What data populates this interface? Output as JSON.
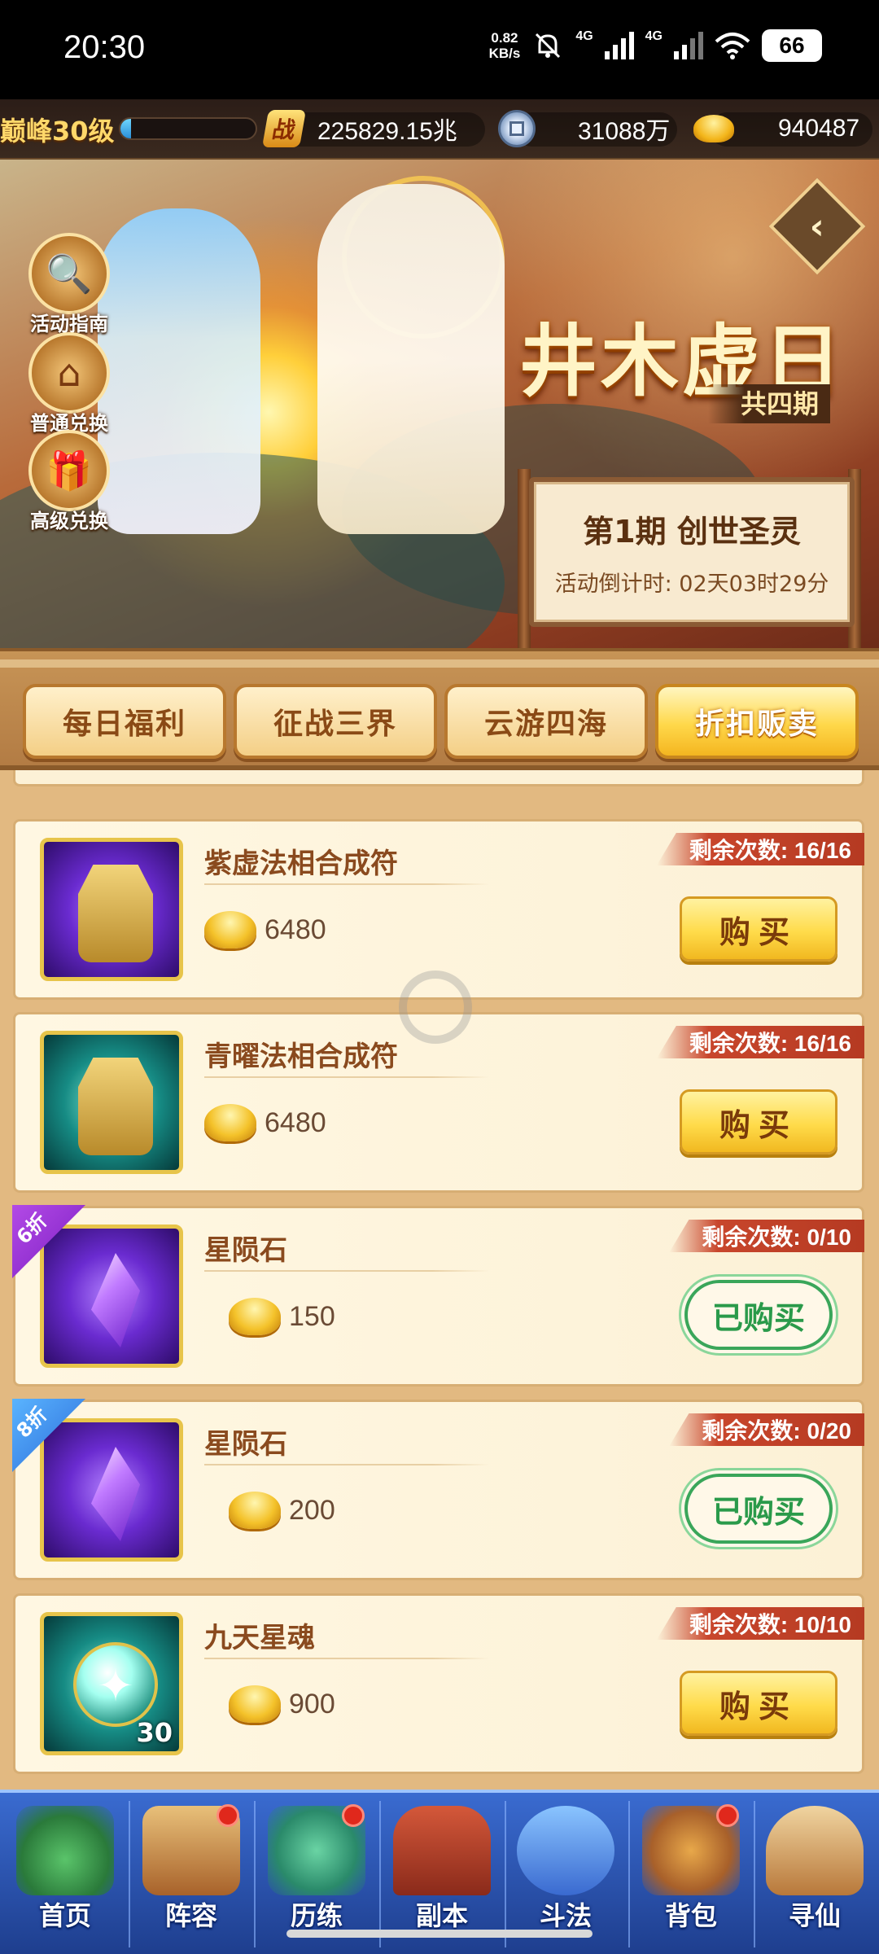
{
  "status_bar": {
    "time": "20:30",
    "net_speed_value": "0.82",
    "net_speed_unit": "KB/s",
    "sig1": "4G",
    "sig2": "4G",
    "battery": "66"
  },
  "resources": {
    "level": "巅峰30级",
    "exp_fraction": 0.08,
    "power_icon": "战",
    "power": "225829.15兆",
    "coins": "31088万",
    "ingots": "940487"
  },
  "banner": {
    "side_buttons": [
      {
        "label": "活动指南",
        "icon": "magnifier-icon",
        "glyph": "🔍"
      },
      {
        "label": "普通兑换",
        "icon": "shop-icon",
        "glyph": "⌂"
      },
      {
        "label": "高级兑换",
        "icon": "gift-icon",
        "glyph": "🎁"
      }
    ],
    "title": "井木虚日",
    "subtitle": "共四期",
    "period_title": "第1期  创世圣灵",
    "countdown": "活动倒计时: 02天03时29分"
  },
  "tabs": [
    {
      "label": "每日福利",
      "active": false
    },
    {
      "label": "征战三界",
      "active": false
    },
    {
      "label": "云游四海",
      "active": false
    },
    {
      "label": "折扣贩卖",
      "active": true
    }
  ],
  "shop_items": [
    {
      "name": "紫虚法相合成符",
      "price": "6480",
      "remaining": "剩余次数: 16/16",
      "button": "购买",
      "bought": false,
      "discount": "",
      "thumb": "purple-talisman"
    },
    {
      "name": "青曜法相合成符",
      "price": "6480",
      "remaining": "剩余次数: 16/16",
      "button": "购买",
      "bought": false,
      "discount": "",
      "thumb": "teal-talisman"
    },
    {
      "name": "星陨石",
      "price": "150",
      "remaining": "剩余次数: 0/10",
      "button": "已购买",
      "bought": true,
      "discount": "6折",
      "thumb": "purple-gem"
    },
    {
      "name": "星陨石",
      "price": "200",
      "remaining": "剩余次数: 0/20",
      "button": "已购买",
      "bought": true,
      "discount": "8折",
      "thumb": "purple-gem"
    },
    {
      "name": "九天星魂",
      "price": "900",
      "remaining": "剩余次数: 10/10",
      "button": "购买",
      "bought": false,
      "discount": "",
      "thumb": "teal-orb",
      "qty": "30"
    }
  ],
  "bottom_nav": [
    {
      "label": "首页",
      "badge": false
    },
    {
      "label": "阵容",
      "badge": true
    },
    {
      "label": "历练",
      "badge": true
    },
    {
      "label": "副本",
      "badge": false
    },
    {
      "label": "斗法",
      "badge": false
    },
    {
      "label": "背包",
      "badge": true
    },
    {
      "label": "寻仙",
      "badge": false
    }
  ],
  "colors": {
    "accent_gold": "#f4c22a",
    "remain_tag": "#c8462c",
    "bought_green": "#2a9a4a",
    "nav_blue": "#2a52b0"
  }
}
